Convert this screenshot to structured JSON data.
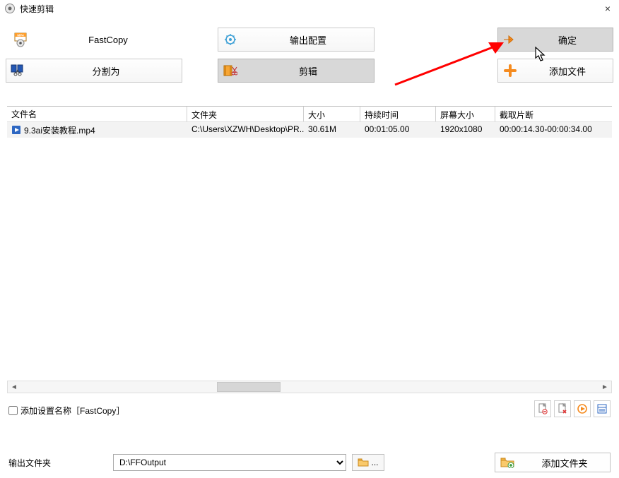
{
  "window": {
    "title": "快速剪辑"
  },
  "toolbar": {
    "fastcopy_label": "FastCopy",
    "output_config_label": "输出配置",
    "confirm_label": "确定",
    "split_label": "分割为",
    "edit_label": "剪辑",
    "add_file_label": "添加文件"
  },
  "table": {
    "headers": {
      "name": "文件名",
      "folder": "文件夹",
      "size": "大小",
      "duration": "持续时间",
      "dimensions": "屏幕大小",
      "clip": "截取片断"
    },
    "rows": [
      {
        "name": "9.3ai安装教程.mp4",
        "folder": "C:\\Users\\XZWH\\Desktop\\PR...",
        "size": "30.61M",
        "duration": "00:01:05.00",
        "dimensions": "1920x1080",
        "clip": "00:00:14.30-00:00:34.00"
      }
    ]
  },
  "bottom": {
    "add_settings_label": "添加设置名称［FastCopy］",
    "output_folder_label": "输出文件夹",
    "output_folder_value": "D:\\FFOutput",
    "browse_dots": "...",
    "add_folder_label": "添加文件夹"
  },
  "icons": {
    "mp4": "MP4",
    "scissors": "✂",
    "plus": "＋"
  }
}
